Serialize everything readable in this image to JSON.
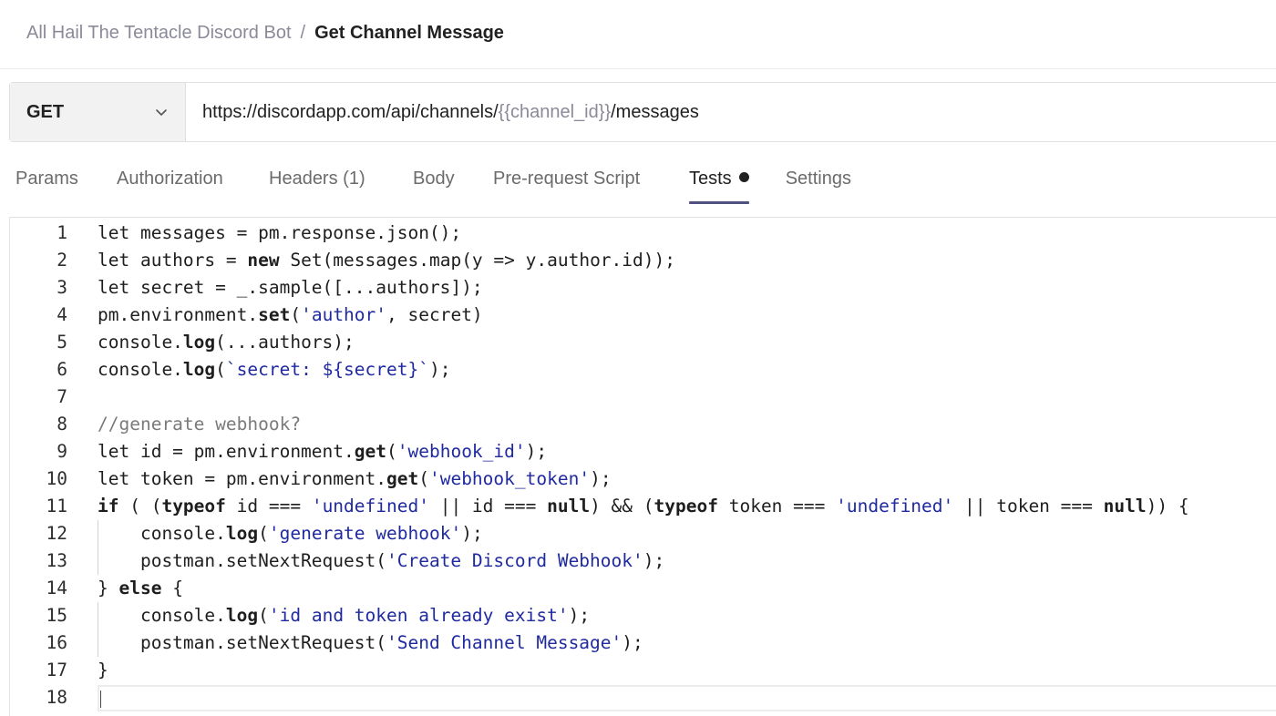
{
  "breadcrumb": {
    "collection": "All Hail The Tentacle Discord Bot",
    "separator": "/",
    "request_name": "Get Channel Message"
  },
  "request": {
    "method": "GET",
    "method_icon": "chevron-down-icon",
    "url_prefix": "https://discordapp.com/api/channels/",
    "url_variable": "{{channel_id}}",
    "url_suffix": "/messages"
  },
  "tabs": [
    {
      "label": "Params"
    },
    {
      "label": "Authorization"
    },
    {
      "label": "Headers",
      "count": "(1)"
    },
    {
      "label": "Body"
    },
    {
      "label": "Pre-request Script"
    },
    {
      "label": "Tests",
      "active": true,
      "indicator": "dot-icon"
    },
    {
      "label": "Settings"
    }
  ],
  "editor": {
    "lines": [
      {
        "num": "1",
        "text": "let messages = pm.response.json();"
      },
      {
        "num": "2",
        "text": "let authors = new Set(messages.map(y => y.author.id));"
      },
      {
        "num": "3",
        "text": "let secret = _.sample([...authors]);"
      },
      {
        "num": "4",
        "text": "pm.environment.set('author', secret)"
      },
      {
        "num": "5",
        "text": "console.log(...authors);"
      },
      {
        "num": "6",
        "text": "console.log(`secret: ${secret}`);"
      },
      {
        "num": "7",
        "text": ""
      },
      {
        "num": "8",
        "text": "//generate webhook?"
      },
      {
        "num": "9",
        "text": "let id = pm.environment.get('webhook_id');"
      },
      {
        "num": "10",
        "text": "let token = pm.environment.get('webhook_token');"
      },
      {
        "num": "11",
        "text": "if ( (typeof id === 'undefined' || id === null) && (typeof token === 'undefined' || token === null)) {"
      },
      {
        "num": "12",
        "text": "    console.log('generate webhook');"
      },
      {
        "num": "13",
        "text": "    postman.setNextRequest('Create Discord Webhook');"
      },
      {
        "num": "14",
        "text": "} else {"
      },
      {
        "num": "15",
        "text": "    console.log('id and token already exist');"
      },
      {
        "num": "16",
        "text": "    postman.setNextRequest('Send Channel Message');"
      },
      {
        "num": "17",
        "text": "}"
      },
      {
        "num": "18",
        "text": ""
      }
    ]
  },
  "colors": {
    "keyword": "#1e1e1e",
    "string": "#1f2aa0",
    "comment": "#7a7a7a",
    "tab_active_underline": "#505081",
    "url_variable": "#8a8a99"
  }
}
